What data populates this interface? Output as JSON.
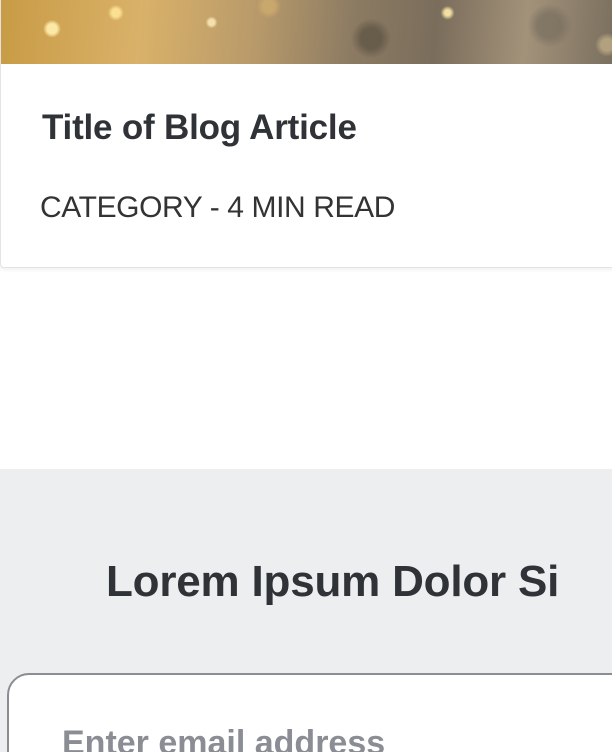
{
  "blog_card": {
    "title": "Title of Blog Article",
    "meta": "CATEGORY - 4 MIN READ"
  },
  "newsletter": {
    "heading": "Lorem Ipsum Dolor Si",
    "email_placeholder": "Enter email address",
    "email_value": ""
  }
}
